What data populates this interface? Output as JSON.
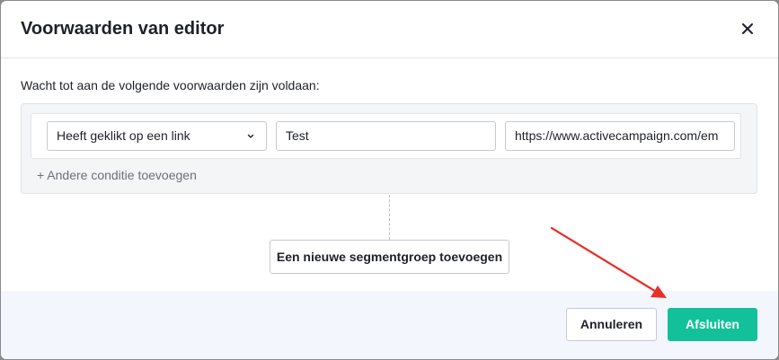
{
  "modal": {
    "title": "Voorwaarden van editor",
    "instruction": "Wacht tot aan de volgende voorwaarden zijn voldaan:"
  },
  "condition": {
    "select_value": "Heeft geklikt op een link",
    "input_value": "Test",
    "url_value": "https://www.activecampaign.com/em"
  },
  "add_condition_label": "+ Andere conditie toevoegen",
  "segment_group_button": "Een nieuwe segmentgroep toevoegen",
  "footer": {
    "cancel_label": "Annuleren",
    "finish_label": "Afsluiten"
  },
  "colors": {
    "primary": "#12c19a",
    "footer_bg": "#f3f6fc",
    "annotation_arrow": "#e8302a"
  },
  "icons": {
    "close": "close-icon",
    "chevron": "chevron-down-icon"
  }
}
